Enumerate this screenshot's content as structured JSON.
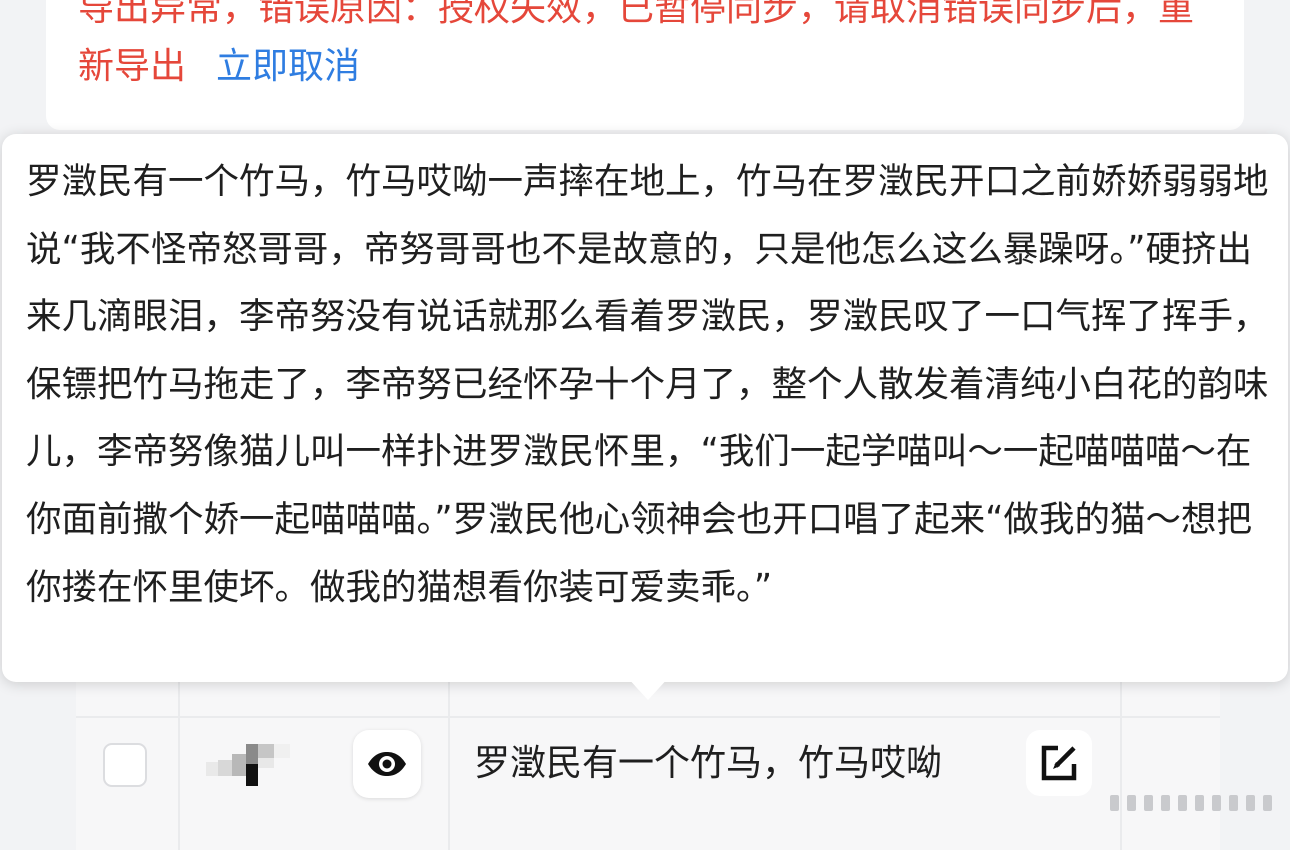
{
  "error_banner": {
    "message": "导出异常，错误原因：授权失效，已暂停同步，请取消错误同步后，重新导出",
    "cancel_link": "立即取消"
  },
  "tooltip": {
    "full_text": "罗澂民有一个竹马，竹马哎呦一声摔在地上，竹马在罗澂民开口之前娇娇弱弱地说“我不怪帝怒哥哥，帝努哥哥也不是故意的，只是他怎么这么暴躁呀。”硬挤出来几滴眼泪，李帝努没有说话就那么看着罗澂民，罗澂民叹了一口气挥了挥手，保镖把竹马拖走了，李帝努已经怀孕十个月了，整个人散发着清纯小白花的韵味儿，李帝努像猫儿叫一样扑进罗澂民怀里，“我们一起学喵叫～一起喵喵喵～在你面前撒个娇一起喵喵喵。”罗澂民他心领神会也开口唱了起来“做我的猫～想把你搂在怀里使坏。做我的猫想看你装可爱卖乖。”"
  },
  "table_row": {
    "content_preview": "罗澂民有一个竹马，竹马哎呦",
    "checked": false
  },
  "icons": {
    "preview": "eye-icon",
    "edit": "edit-icon"
  },
  "colors": {
    "error_text": "#e5473a",
    "link": "#2f7de1"
  }
}
